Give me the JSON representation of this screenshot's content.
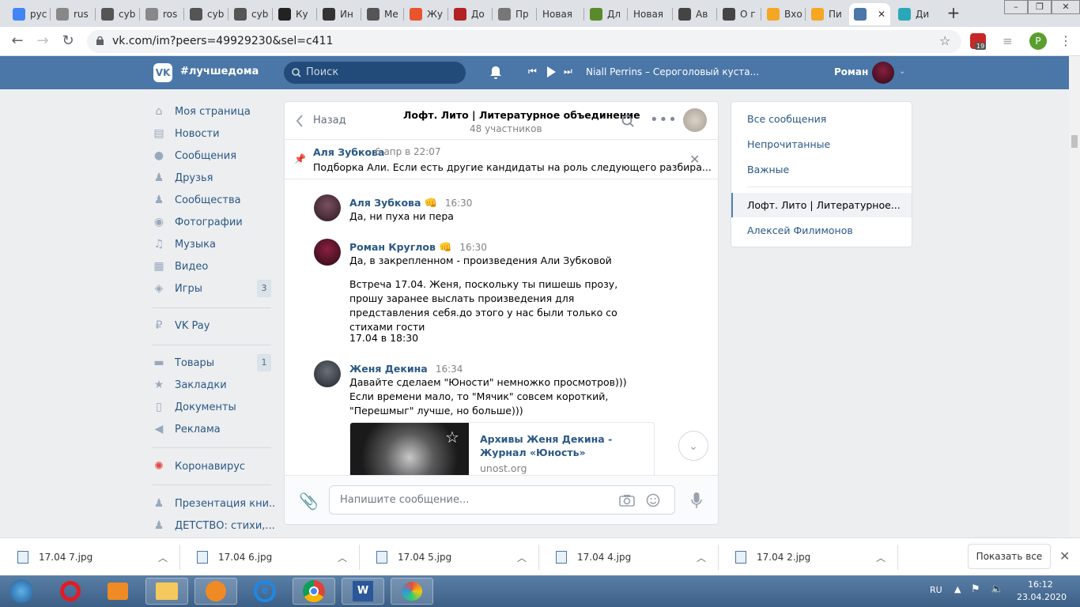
{
  "browser": {
    "tabs": [
      {
        "label": "рус",
        "icon": "google-icon",
        "color": "#4285f4"
      },
      {
        "label": "rus",
        "icon": "generic-favicon",
        "color": "#888888"
      },
      {
        "label": "cyb",
        "icon": "cyberleninka-icon",
        "color": "#555555"
      },
      {
        "label": "ros",
        "icon": "generic-favicon",
        "color": "#888888"
      },
      {
        "label": "cyb",
        "icon": "cyberleninka-icon",
        "color": "#555555"
      },
      {
        "label": "cyb",
        "icon": "cyberleninka-icon",
        "color": "#555555"
      },
      {
        "label": "Ку",
        "icon": "h-favicon",
        "color": "#222222"
      },
      {
        "label": "Ин",
        "icon": "wikipedia-icon",
        "color": "#333333"
      },
      {
        "label": "Ме",
        "icon": "generic-favicon",
        "color": "#555555"
      },
      {
        "label": "Жу",
        "icon": "e-favicon",
        "color": "#e8542d"
      },
      {
        "label": "До",
        "icon": "doc-favicon",
        "color": "#b22222"
      },
      {
        "label": "Пр",
        "icon": "doc-favicon",
        "color": "#777777"
      },
      {
        "label": "Новая",
        "icon": "",
        "color": ""
      },
      {
        "label": "Дл",
        "icon": "m-favicon",
        "color": "#5a8a2b"
      },
      {
        "label": "Новая",
        "icon": "",
        "color": ""
      },
      {
        "label": "Ав",
        "icon": "generic-favicon",
        "color": "#444444"
      },
      {
        "label": "О г",
        "icon": "generic-favicon",
        "color": "#444444"
      },
      {
        "label": "Вхо",
        "icon": "mail-favicon",
        "color": "#f5a623"
      },
      {
        "label": "Пи",
        "icon": "mail-favicon",
        "color": "#f5a623"
      },
      {
        "label": "",
        "icon": "vk-message-icon",
        "color": "#4a76a8",
        "active": true
      },
      {
        "label": "Ди",
        "icon": "globe-favicon",
        "color": "#2aa8b8"
      }
    ],
    "url": "vk.com/im?peers=49929230&sel=c411",
    "ext_badge": "19",
    "profile_letter": "P"
  },
  "header": {
    "logo": "VK",
    "brand": "#лучшедома",
    "search_placeholder": "Поиск",
    "now_playing": "Niall Perrins – Сероголовый куста...",
    "user_name": "Роман"
  },
  "menu": [
    {
      "label": "Моя страница",
      "icon": "home-icon"
    },
    {
      "label": "Новости",
      "icon": "news-icon"
    },
    {
      "label": "Сообщения",
      "icon": "messages-icon"
    },
    {
      "label": "Друзья",
      "icon": "friends-icon"
    },
    {
      "label": "Сообщества",
      "icon": "communities-icon"
    },
    {
      "label": "Фотографии",
      "icon": "camera-icon"
    },
    {
      "label": "Музыка",
      "icon": "music-icon"
    },
    {
      "label": "Видео",
      "icon": "video-icon"
    },
    {
      "label": "Игры",
      "icon": "games-icon",
      "counter": "3"
    },
    {
      "label": "VK Pay",
      "icon": "vkpay-icon"
    },
    {
      "label": "Товары",
      "icon": "goods-icon",
      "counter": "1"
    },
    {
      "label": "Закладки",
      "icon": "star-icon"
    },
    {
      "label": "Документы",
      "icon": "document-icon"
    },
    {
      "label": "Реклама",
      "icon": "megaphone-icon"
    },
    {
      "label": "Коронавирус",
      "icon": "virus-icon"
    },
    {
      "label": "Презентация кни..",
      "icon": "group-icon"
    },
    {
      "label": "ДЕТСТВО: стихи,...",
      "icon": "group-icon"
    }
  ],
  "chat": {
    "back_label": "Назад",
    "title": "Лофт. Лито | Литературное объединение",
    "subtitle": "48 участников",
    "pinned": {
      "author": "Аля Зубкова",
      "time": "6 апр в 22:07",
      "text": "Подборка Али. Если есть другие кандидаты на роль следующего разбира..."
    },
    "messages": [
      {
        "author": "Аля Зубкова",
        "emoji": "👊",
        "time": "16:30",
        "lines": [
          "Да, ни пуха ни пера"
        ]
      },
      {
        "author": "Роман Круглов",
        "emoji": "👊",
        "time": "16:30",
        "lines": [
          "Да, в закрепленном - произведения Али Зубковой"
        ],
        "extra": "Встреча 17.04. Женя, поскольку ты пишешь прозу, прошу заранее выслать произведения для представления себя.до этого у нас были только со стихами гости",
        "extra2": "17.04 в 18:30"
      },
      {
        "author": "Женя Декина",
        "emoji": "",
        "time": "16:34",
        "lines": [
          "Давайте сделаем \"Юности\" немножко просмотров))) Если времени мало, то \"Мячик\" совсем короткий, \"Перешмыг\" лучше, но больше)))"
        ]
      }
    ],
    "link": {
      "title": "Архивы Женя Декина - Журнал «Юность»",
      "domain": "unost.org"
    },
    "composer_placeholder": "Напишите сообщение..."
  },
  "right_panel": {
    "items": [
      "Все сообщения",
      "Непрочитанные",
      "Важные"
    ],
    "conversations": [
      "Лофт. Лито | Литературное...",
      "Алексей Филимонов"
    ]
  },
  "downloads": {
    "files": [
      "17.04 7.jpg",
      "17.04 6.jpg",
      "17.04 5.jpg",
      "17.04 4.jpg",
      "17.04 2.jpg"
    ],
    "show_all": "Показать все"
  },
  "taskbar": {
    "lang": "RU",
    "time": "16:12",
    "date": "23.04.2020"
  },
  "colors": {
    "vk_blue": "#4a76a8",
    "link": "#2a5885"
  }
}
